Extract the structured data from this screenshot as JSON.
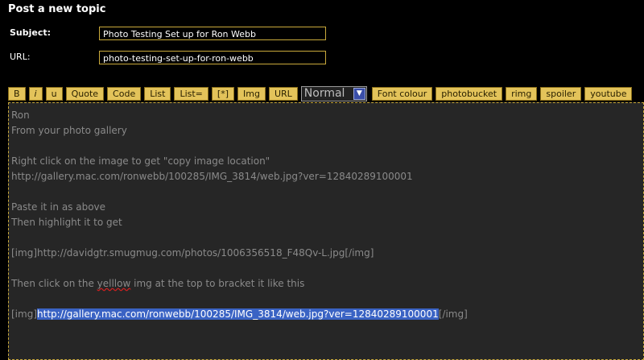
{
  "form": {
    "heading": "Post a new topic",
    "subject_label": "Subject:",
    "subject_value": "Photo Testing Set up for Ron Webb",
    "url_label": "URL:",
    "url_value": "photo-testing-set-up-for-ron-webb"
  },
  "toolbar": {
    "bold": "B",
    "italic": "i",
    "underline": "u",
    "quote": "Quote",
    "code": "Code",
    "list": "List",
    "list_ordered": "List=",
    "list_item": "[*]",
    "img": "Img",
    "url": "URL",
    "font_size_selected": "Normal",
    "font_colour": "Font colour",
    "photobucket": "photobucket",
    "rimg": "rimg",
    "spoiler": "spoiler",
    "youtube": "youtube"
  },
  "editor": {
    "line1": "Ron",
    "line2": "From your photo gallery",
    "line3": "Right click on the image to get \"copy image location\"",
    "line4": "http://gallery.mac.com/ronwebb/100285/IMG_3814/web.jpg?ver=12840289100001",
    "line5": "Paste it in as above",
    "line6": "Then highlight it to get",
    "line7": "[img]http://davidgtr.smugmug.com/photos/1006356518_F48Qv-L.jpg[/img]",
    "line8_pre": "Then click on the ",
    "line8_word": "yelllow",
    "line8_post": " img at the top to bracket it like this",
    "line9_open": "[img]",
    "line9_selected": "http://gallery.mac.com/ronwebb/100285/IMG_3814/web.jpg?ver=12840289100001",
    "line9_close": "[/img]"
  },
  "colors": {
    "accent_button": "#e3c35a",
    "input_border": "#c9a93b",
    "editor_bg": "#262626",
    "selection": "#3a63c4"
  }
}
